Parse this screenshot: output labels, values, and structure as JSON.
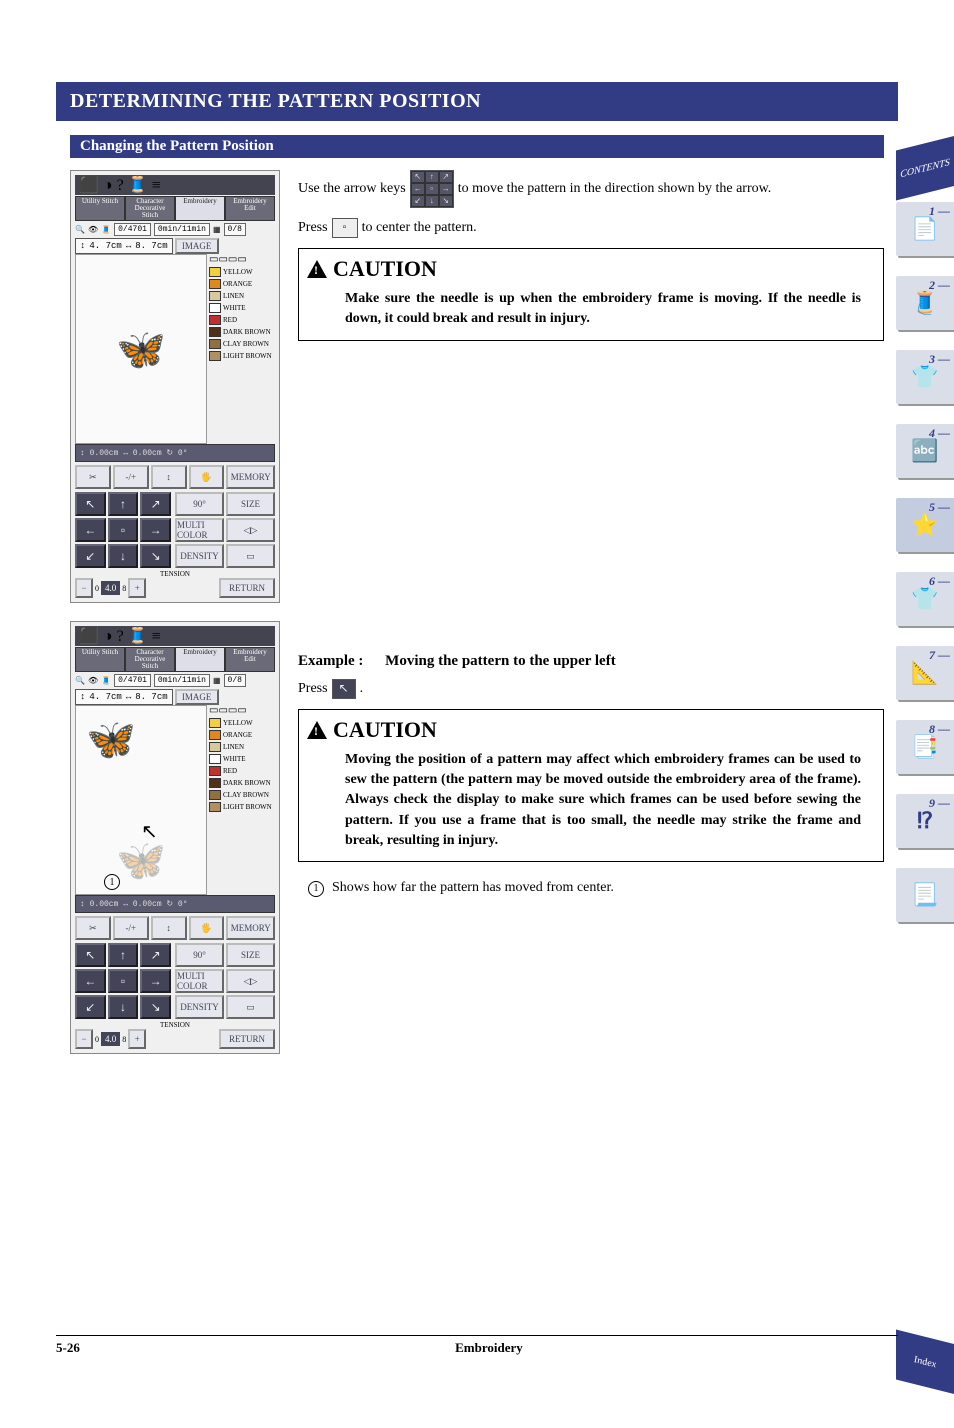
{
  "page": {
    "banner_title": "DETERMINING THE PATTERN POSITION",
    "sub_heading": "Changing the Pattern Position",
    "footer_page": "5-26",
    "footer_section": "Embroidery"
  },
  "corner_tabs": {
    "top": "CONTENTS",
    "bottom": "Index"
  },
  "side_tabs": [
    {
      "num": "1 —"
    },
    {
      "num": "2 —"
    },
    {
      "num": "3 —"
    },
    {
      "num": "4 —"
    },
    {
      "num": "5 —"
    },
    {
      "num": "6 —"
    },
    {
      "num": "7 —"
    },
    {
      "num": "8 —"
    },
    {
      "num": "9 —"
    },
    {
      "num": ""
    }
  ],
  "machine_screen": {
    "tabs": [
      "Utility Stitch",
      "Character Decorative Stitch",
      "Embroidery",
      "Embroidery Edit"
    ],
    "selected_tab": 2,
    "stats": {
      "count": "0",
      "total": "4701",
      "time_current": "0min",
      "time_total": "11min",
      "thread": "0",
      "steps": "8"
    },
    "dims_h": "4. 7cm",
    "dims_w": "8. 7cm",
    "image_btn": "IMAGE",
    "colors": [
      {
        "name": "YELLOW",
        "hex": "#f0d040"
      },
      {
        "name": "ORANGE",
        "hex": "#e08820"
      },
      {
        "name": "LINEN",
        "hex": "#d8c8a0"
      },
      {
        "name": "WHITE",
        "hex": "#ffffff"
      },
      {
        "name": "RED",
        "hex": "#c03030"
      },
      {
        "name": "DARK BROWN",
        "hex": "#503018"
      },
      {
        "name": "CLAY BROWN",
        "hex": "#907040"
      },
      {
        "name": "LIGHT BROWN",
        "hex": "#b09060"
      }
    ],
    "posbar": "↕   0.00cm  ↔   0.00cm  ↻   0°",
    "row1": {
      "cut": "✂",
      "adj": "-/+",
      "needle": "↕",
      "mirror": "🖐",
      "memory": "MEMORY"
    },
    "row3": {
      "rotate": "90°",
      "size": "SIZE",
      "multi": "MULTI COLOR",
      "density": "DENSITY"
    },
    "tension": {
      "label": "TENSION",
      "min": "0",
      "val": "4.0",
      "max": "8",
      "minus": "−",
      "plus": "+"
    },
    "return_btn": "RETURN",
    "arrows": {
      "ul": "↖",
      "u": "↑",
      "ur": "↗",
      "l": "←",
      "c": "▫",
      "r": "→",
      "dl": "↙",
      "d": "↓",
      "dr": "↘"
    }
  },
  "body_text": {
    "para1_a": "Use the arrow keys",
    "para1_b": "to move the pattern in the direction shown by the arrow.",
    "para2_a": "Press",
    "para2_b": "to center the pattern.",
    "caution_title": "CAUTION",
    "caution1": "Make sure the needle is up when the embroidery frame is moving. If the needle is down, it could break and result in injury.",
    "example_label": "Example :",
    "example_text": "Moving the pattern to the upper left",
    "press_a": "Press",
    "press_b": ".",
    "caution2": "Moving the position of a pattern may affect which embroidery frames can be used to sew the pattern (the pattern may be moved outside the embroidery area of the frame). Always check the display to make sure which frames can be used before sewing the pattern. If you use a frame that is too small, the needle may strike the frame and break, resulting in injury.",
    "note1_num": "1",
    "note1": "Shows how far the pattern has moved from center.",
    "annot1_num": "1"
  }
}
